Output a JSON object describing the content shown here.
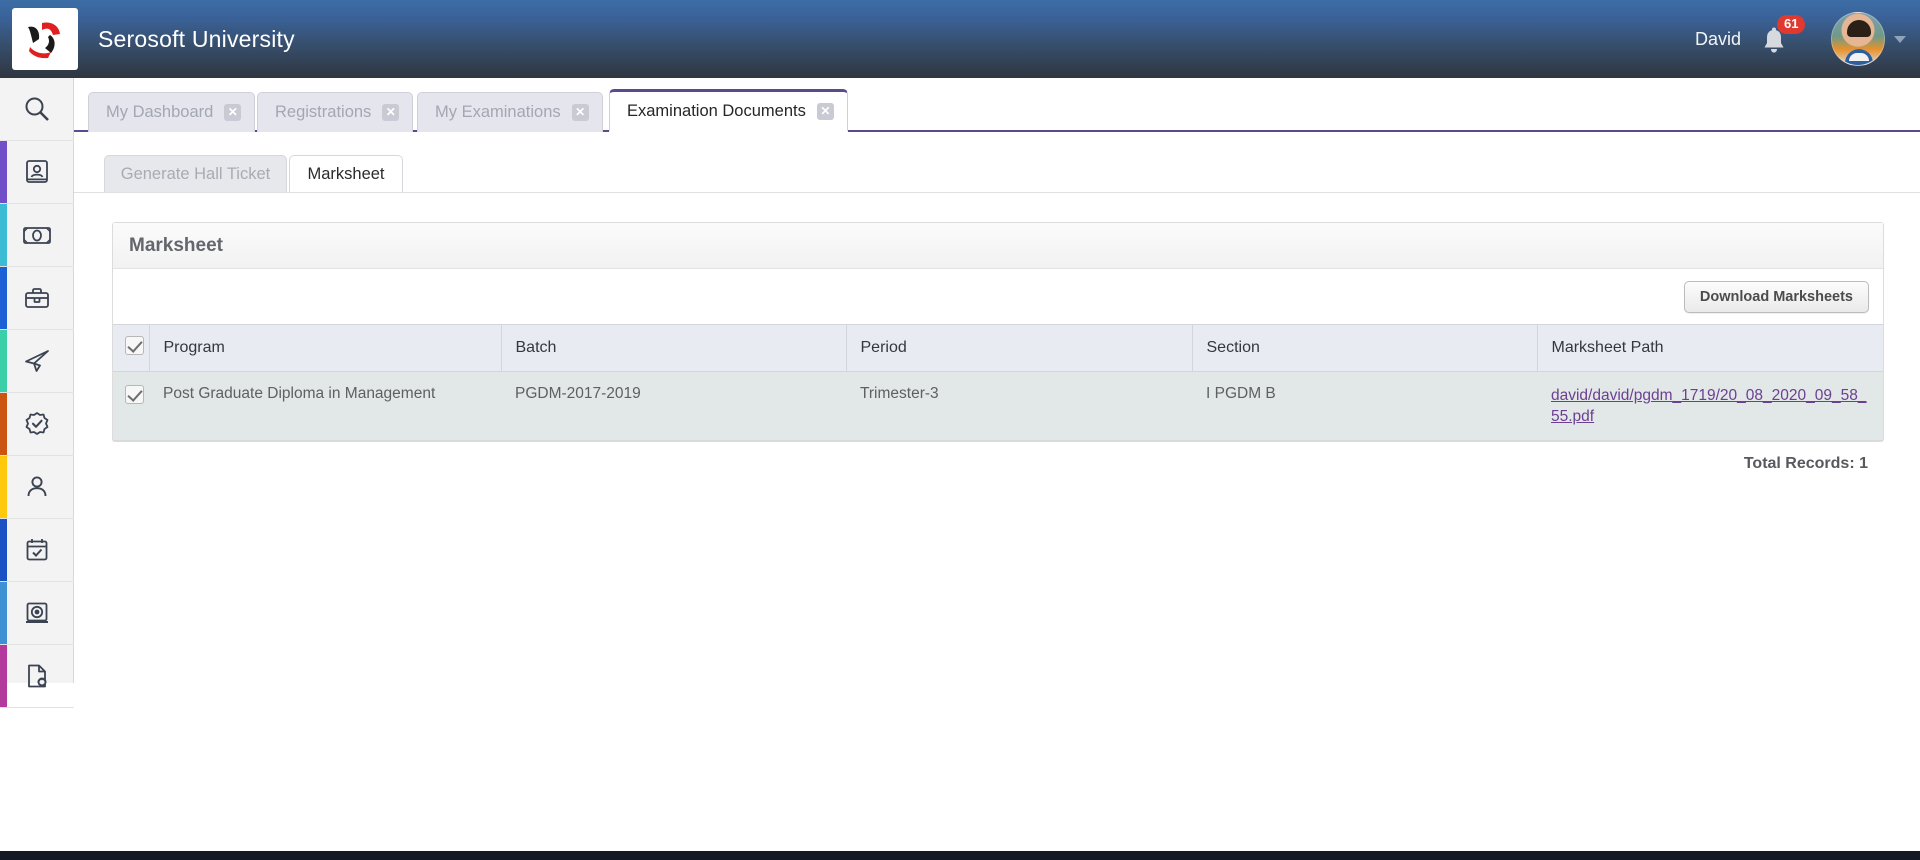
{
  "app": {
    "brand_title": "Serosoft University",
    "logo_icon": "serosoft-pinwheel-logo"
  },
  "header": {
    "user_name": "David",
    "notification_icon": "bell-icon",
    "notification_count": "61",
    "avatar_icon": "user-avatar",
    "caret_icon": "chevron-down-icon",
    "gradient_top": "#3c6da6",
    "gradient_bottom": "#2f3640"
  },
  "sidebar": {
    "items": [
      {
        "name": "search",
        "icon": "search-icon",
        "accent": ""
      },
      {
        "name": "admissions",
        "icon": "contact-card-icon",
        "accent": "#6f4ec7"
      },
      {
        "name": "fees",
        "icon": "banknote-icon",
        "accent": "#3bbcd4"
      },
      {
        "name": "placements",
        "icon": "briefcase-icon",
        "accent": "#1d5fd4"
      },
      {
        "name": "communications",
        "icon": "paper-plane-icon",
        "accent": "#3ccfa8"
      },
      {
        "name": "settings",
        "icon": "gear-check-icon",
        "accent": "#cc5511"
      },
      {
        "name": "profile",
        "icon": "person-icon",
        "accent": "#fdc90a"
      },
      {
        "name": "attendance",
        "icon": "calendar-check-icon",
        "accent": "#1a52c4"
      },
      {
        "name": "examinations",
        "icon": "monitor-disk-icon",
        "accent": "#3e92d4"
      },
      {
        "name": "documents",
        "icon": "document-gear-icon",
        "accent": "#b4399c"
      }
    ]
  },
  "tabs": {
    "active_accent": "#5b4a8e",
    "items": [
      {
        "label": "My Dashboard",
        "active": false,
        "close_icon": "close-icon"
      },
      {
        "label": "Registrations",
        "active": false,
        "close_icon": "close-icon"
      },
      {
        "label": "My Examinations",
        "active": false,
        "close_icon": "close-icon"
      },
      {
        "label": "Examination Documents",
        "active": true,
        "close_icon": "close-icon"
      }
    ]
  },
  "subtabs": {
    "items": [
      {
        "label": "Generate Hall Ticket",
        "active": false
      },
      {
        "label": "Marksheet",
        "active": true
      }
    ]
  },
  "panel": {
    "title": "Marksheet",
    "download_button": "Download Marksheets"
  },
  "table": {
    "select_all_checkbox": "checked",
    "columns": [
      "Program",
      "Batch",
      "Period",
      "Section",
      "Marksheet Path"
    ],
    "rows": [
      {
        "selected": "checked",
        "program": "Post Graduate Diploma in Management",
        "batch": "PGDM-2017-2019",
        "period": "Trimester-3",
        "section": "I PGDM B",
        "marksheet_path": "david/david/pgdm_1719/20_08_2020_09_58_55.pdf"
      }
    ],
    "total_records": "Total Records: 1"
  }
}
